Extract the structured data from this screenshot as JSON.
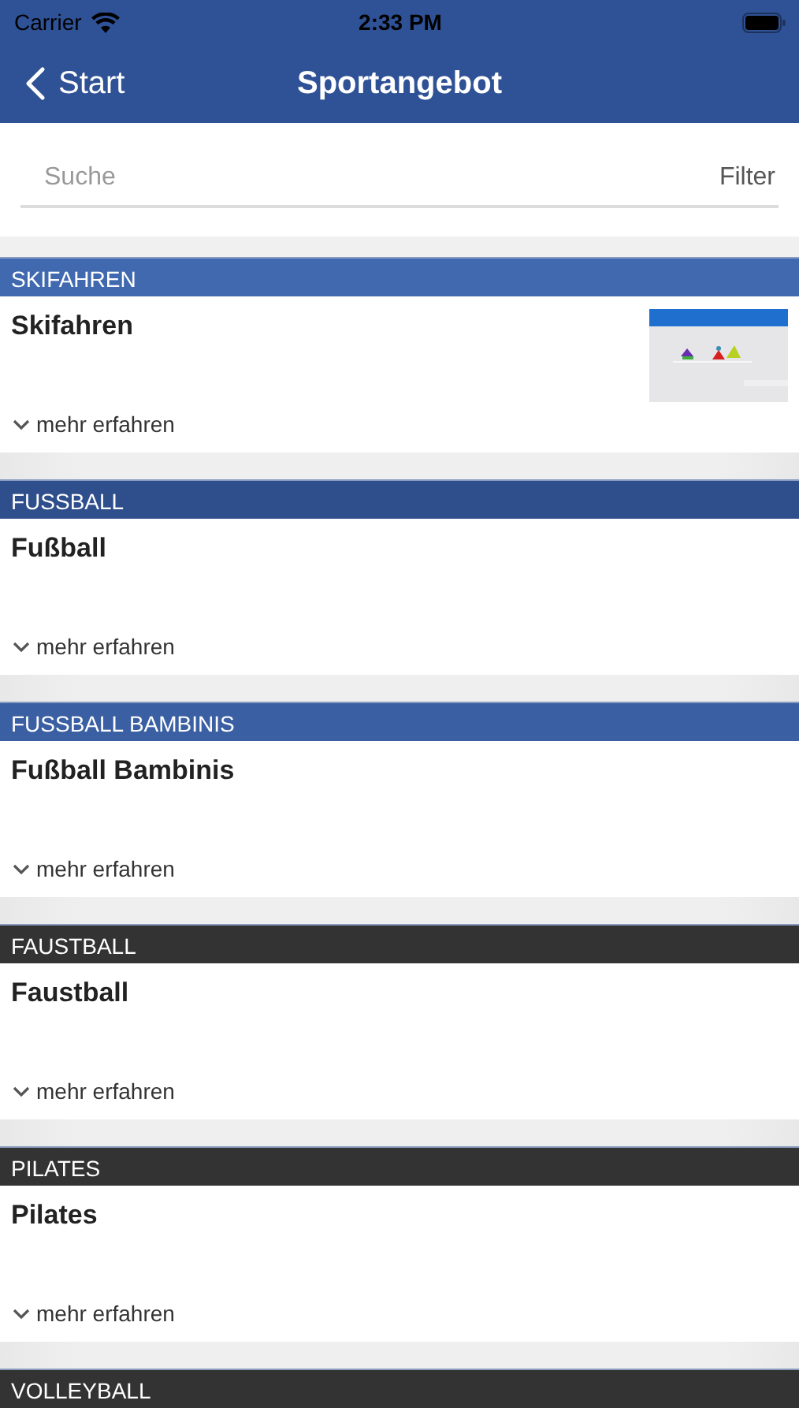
{
  "status_bar": {
    "carrier": "Carrier",
    "time": "2:33 PM"
  },
  "nav": {
    "back": "Start",
    "title": "Sportangebot"
  },
  "search": {
    "placeholder": "Suche",
    "filter": "Filter"
  },
  "sections": [
    {
      "header": "SKIFAHREN",
      "color": "#4169b0",
      "title": "Skifahren",
      "more": "mehr erfahren"
    },
    {
      "header": "FUSSBALL",
      "color": "#2e4e8c",
      "title": "Fußball",
      "more": "mehr erfahren"
    },
    {
      "header": "FUSSBALL BAMBINIS",
      "color": "#3a5fa3",
      "title": "Fußball Bambinis",
      "more": "mehr erfahren"
    },
    {
      "header": "FAUSTBALL",
      "color": "#333333",
      "title": "Faustball",
      "more": "mehr erfahren"
    },
    {
      "header": "PILATES",
      "color": "#333333",
      "title": "Pilates",
      "more": "mehr erfahren"
    },
    {
      "header": "VOLLEYBALL",
      "color": "#333333"
    }
  ]
}
